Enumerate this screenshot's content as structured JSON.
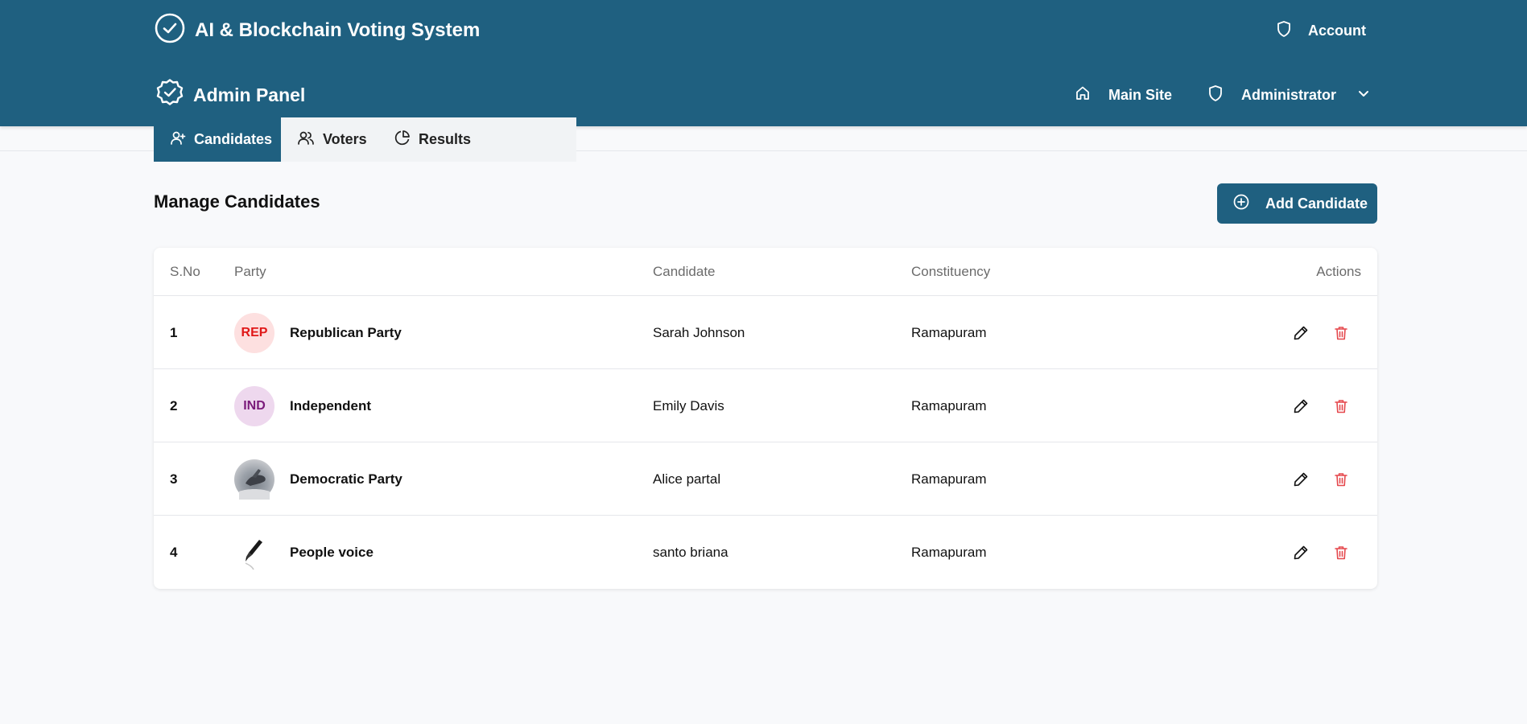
{
  "header": {
    "app_title": "AI & Blockchain Voting System",
    "account_label": "Account",
    "panel_title": "Admin Panel",
    "main_site_label": "Main Site",
    "admin_label": "Administrator"
  },
  "tabs": [
    {
      "label": "Candidates",
      "icon": "user-plus-icon",
      "active": true
    },
    {
      "label": "Voters",
      "icon": "users-icon",
      "active": false
    },
    {
      "label": "Results",
      "icon": "pie-chart-icon",
      "active": false
    }
  ],
  "main": {
    "title": "Manage Candidates",
    "add_button_label": "Add Candidate"
  },
  "table": {
    "columns": [
      "S.No",
      "Party",
      "Candidate",
      "Constituency",
      "Actions"
    ],
    "rows": [
      {
        "sno": "1",
        "party_logo_text": "REP",
        "party": "Republican Party",
        "candidate": "Sarah Johnson",
        "constituency": "Ramapuram"
      },
      {
        "sno": "2",
        "party_logo_text": "IND",
        "party": "Independent",
        "candidate": "Emily Davis",
        "constituency": "Ramapuram"
      },
      {
        "sno": "3",
        "party_logo_text": "",
        "party": "Democratic Party",
        "candidate": "Alice partal",
        "constituency": "Ramapuram"
      },
      {
        "sno": "4",
        "party_logo_text": "",
        "party": "People voice",
        "candidate": "santo briana",
        "constituency": "Ramapuram"
      }
    ]
  },
  "colors": {
    "brand": "#1f6080",
    "delete": "#e5484d",
    "background": "#f8f9fb"
  }
}
